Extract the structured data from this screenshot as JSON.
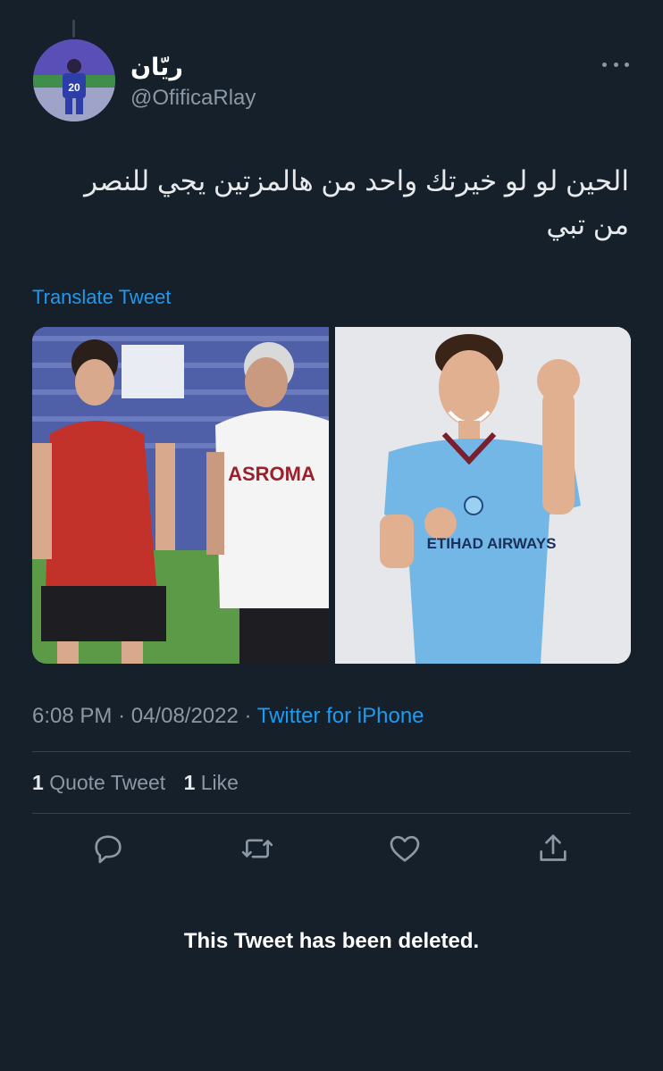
{
  "tweet": {
    "author": {
      "display_name": "ريّان",
      "handle": "@OfificaRlay",
      "avatar_jersey_number": "20"
    },
    "text": "الحين لو لو خيرتك واحد من هالمزتين يجي للنصر من تبي",
    "translate_label": "Translate Tweet",
    "media": {
      "left_shirt_text": "ASROMA",
      "right_shirt_text": "ETIHAD AIRWAYS"
    },
    "meta": {
      "time": "6:08 PM",
      "date": "04/08/2022",
      "separator": "·",
      "source": "Twitter for iPhone"
    },
    "stats": {
      "quote_count": "1",
      "quote_label": "Quote Tweet",
      "like_count": "1",
      "like_label": "Like"
    },
    "actions": [
      "reply-icon",
      "retweet-icon",
      "like-icon",
      "share-icon"
    ]
  },
  "notice": {
    "deleted_text": "This Tweet has been deleted."
  },
  "colors": {
    "background": "#15202b",
    "text": "#e7e9ea",
    "secondary": "#8b98a5",
    "link": "#1d9bf0",
    "divider": "#38444d"
  }
}
